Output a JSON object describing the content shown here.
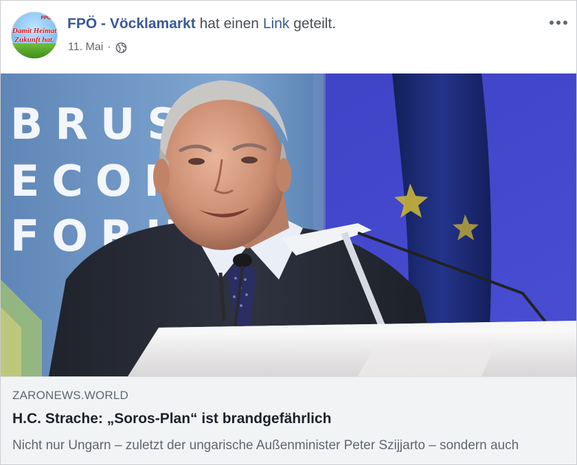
{
  "header": {
    "page_name": "FPÖ - Vöcklamarkt",
    "action_text_1": "hat einen",
    "action_link": "Link",
    "action_text_2": "geteilt.",
    "date": "11. Mai",
    "separator": "·",
    "privacy_icon": "globe-icon",
    "more_icon": "more-options-icon"
  },
  "avatar": {
    "line1": "Damit Heimat",
    "line2": "Zukunft hat.",
    "badge": "FPÖ"
  },
  "photo": {
    "backdrop_text_lines": [
      "BRUSS",
      "ECONO",
      "FORU"
    ]
  },
  "link_preview": {
    "domain": "ZARONEWS.WORLD",
    "headline": "H.C. Strache: „Soros-Plan“ ist brandgefährlich",
    "description": "Nicht nur Ungarn – zuletzt der ungarische Außenminister Peter Szijjarto – sondern auch"
  },
  "colors": {
    "link_blue": "#385898",
    "meta_gray": "#616770",
    "caption_bg": "#f2f3f5",
    "headline": "#1d2129",
    "stage_blue": "#3d3fb8"
  }
}
